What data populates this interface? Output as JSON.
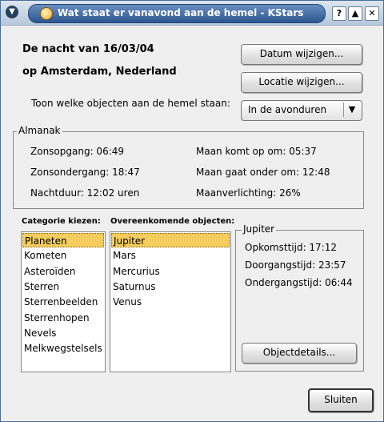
{
  "window": {
    "title": "Wat staat er vanavond aan de hemel - KStars",
    "help_label": "?",
    "maximize_label": "▲",
    "close_label": "✕"
  },
  "header": {
    "night_line": "De nacht van 16/03/04",
    "location_line": "op Amsterdam, Nederland",
    "change_date_label": "Datum wijzigen...",
    "change_location_label": "Locatie wijzigen..."
  },
  "show_objects": {
    "label": "Toon welke objecten aan de hemel staan:",
    "selected": "In de avonduren"
  },
  "almanac": {
    "title": "Almanak",
    "sunrise": "Zonsopgang: 06:49",
    "sunset": "Zonsondergang: 18:47",
    "night_length": "Nachtduur: 12:02 uren",
    "moonrise": "Maan komt op om: 05:37",
    "moonset": "Maan gaat onder om: 12:48",
    "moon_illumination": "Maanverlichting: 26%"
  },
  "categories": {
    "label": "Categorie kiezen:",
    "items": [
      "Planeten",
      "Kometen",
      "Asteroïden",
      "Sterren",
      "Sterrenbeelden",
      "Sterrenhopen",
      "Nevels",
      "Melkwegstelsels"
    ]
  },
  "matches": {
    "label": "Overeenkomende objecten:",
    "items": [
      "Jupiter",
      "Mars",
      "Mercurius",
      "Saturnus",
      "Venus"
    ]
  },
  "details": {
    "title": "Jupiter",
    "rise": "Opkomsttijd: 17:12",
    "transit": "Doorgangstijd: 23:57",
    "set": "Ondergangstijd: 06:44",
    "button_label": "Objectdetails..."
  },
  "footer": {
    "close_label": "Sluiten"
  }
}
